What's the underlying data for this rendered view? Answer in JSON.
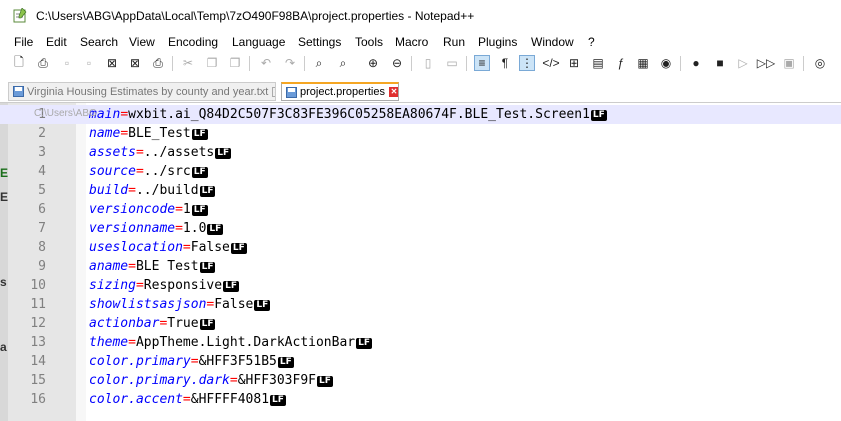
{
  "window": {
    "title": "C:\\Users\\ABG\\AppData\\Local\\Temp\\7zO490F98BA\\project.properties - Notepad++"
  },
  "menu": [
    "File",
    "Edit",
    "Search",
    "View",
    "Encoding",
    "Language",
    "Settings",
    "Tools",
    "Macro",
    "Run",
    "Plugins",
    "Window",
    "?"
  ],
  "toolbar": {
    "icons": [
      "new-file-icon",
      "open-file-icon",
      "save-icon",
      "save-all-icon",
      "close-icon",
      "close-all-icon",
      "print-icon",
      "cut-icon",
      "copy-icon",
      "paste-icon",
      "undo-icon",
      "redo-icon",
      "find-icon",
      "replace-icon",
      "zoom-in-icon",
      "zoom-out-icon",
      "sync-vertical-icon",
      "sync-horizontal-icon",
      "word-wrap-icon",
      "show-all-characters-icon",
      "indent-guide-icon",
      "html-tag-icon",
      "document-map-icon",
      "document-list-icon",
      "function-list-icon",
      "folder-as-workspace-icon",
      "monitoring-icon",
      "record-macro-icon",
      "stop-record-icon",
      "play-macro-icon",
      "run-macro-multiple-icon",
      "save-macro-icon",
      "spell-check-icon"
    ]
  },
  "tabs": [
    {
      "label": "Virginia Housing Estimates by county and year.txt",
      "active": false
    },
    {
      "label": "project.properties",
      "active": true
    }
  ],
  "background_ghost_text": "C:\\Users\\ABG",
  "eol_marker": "LF",
  "lines": [
    {
      "num": "1",
      "key": "main",
      "value": "wxbit.ai_Q84D2C507F3C83FE396C05258EA80674F.BLE_Test.Screen1"
    },
    {
      "num": "2",
      "key": "name",
      "value": "BLE_Test"
    },
    {
      "num": "3",
      "key": "assets",
      "value": "../assets"
    },
    {
      "num": "4",
      "key": "source",
      "value": "../src"
    },
    {
      "num": "5",
      "key": "build",
      "value": "../build"
    },
    {
      "num": "6",
      "key": "versioncode",
      "value": "1"
    },
    {
      "num": "7",
      "key": "versionname",
      "value": "1.0"
    },
    {
      "num": "8",
      "key": "useslocation",
      "value": "False"
    },
    {
      "num": "9",
      "key": "aname",
      "value": "BLE Test"
    },
    {
      "num": "10",
      "key": "sizing",
      "value": "Responsive"
    },
    {
      "num": "11",
      "key": "showlistsasjson",
      "value": "False"
    },
    {
      "num": "12",
      "key": "actionbar",
      "value": "True"
    },
    {
      "num": "13",
      "key": "theme",
      "value": "AppTheme.Light.DarkActionBar"
    },
    {
      "num": "14",
      "key": "color.primary",
      "value": "&HFF3F51B5"
    },
    {
      "num": "15",
      "key": "color.primary.dark",
      "value": "&HFF303F9F"
    },
    {
      "num": "16",
      "key": "color.accent",
      "value": "&HFFFF4081"
    }
  ],
  "colors": {
    "key": "#0000ff",
    "equals": "#ff0000",
    "value": "#000000",
    "current_line": "#e8e8ff",
    "active_tab_accent": "#f5a623"
  }
}
